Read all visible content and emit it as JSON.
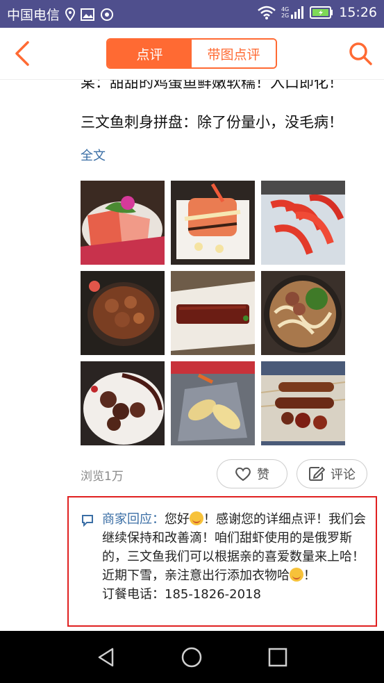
{
  "status_bar": {
    "carrier": "中国电信",
    "network": "4G",
    "network2": "2G",
    "time": "15:26"
  },
  "header": {
    "tabs": [
      {
        "label": "点评",
        "active": true
      },
      {
        "label": "带图点评",
        "active": false
      }
    ]
  },
  "review": {
    "cut_line": "某：甜甜的鸡蛋鱼鲜嫩软糯！入口即化！",
    "line": "三文鱼刺身拼盘：除了份量小，没毛病！",
    "full_text_link": "全文",
    "views": "浏览1万",
    "like_label": "赞",
    "comment_label": "评论"
  },
  "photos": [
    {
      "name": "sashimi-platter-photo"
    },
    {
      "name": "salmon-roll-photo"
    },
    {
      "name": "sweet-shrimp-photo"
    },
    {
      "name": "beef-bowl-photo"
    },
    {
      "name": "grilled-eel-photo"
    },
    {
      "name": "udon-noodle-photo"
    },
    {
      "name": "grilled-meat-photo"
    },
    {
      "name": "tempura-shrimp-photo"
    },
    {
      "name": "skewers-photo"
    }
  ],
  "merchant_reply": {
    "label": "商家回应：",
    "line1_a": "您好",
    "line1_b": "！感谢您的详细点评！我们会继续保持和改善滴！咱们甜虾使用的是俄罗斯的，三文鱼我们可以根据亲的喜爱数量来上哈！",
    "line2_a": "近期下雪，亲注意出行添加衣物哈",
    "line2_b": "！",
    "line3": "订餐电话：185-1826-2018"
  },
  "colors": {
    "accent": "#ff6a33",
    "link": "#3a6ea5",
    "status_bar": "#4f4f8d",
    "highlight_border": "#e02020"
  }
}
